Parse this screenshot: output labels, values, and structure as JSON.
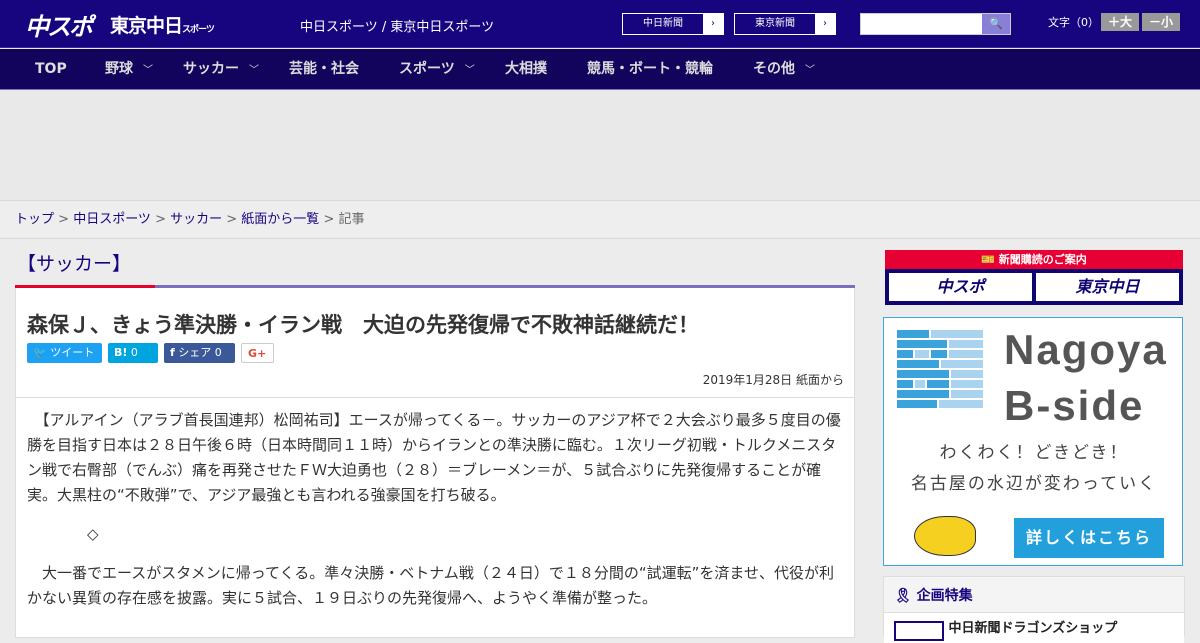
{
  "header": {
    "logo_chuspo": "中スポ",
    "logo_tokyo": "東京中日",
    "logo_tokyo_small": "スポーツ",
    "tagline": "中日スポーツ / 東京中日スポーツ",
    "link1": "中日新聞",
    "link2": "東京新聞",
    "search_placeholder": "",
    "font_label": "文字（0）",
    "font_up": "＋大",
    "font_down": "－小"
  },
  "nav": [
    {
      "label": "TOP"
    },
    {
      "label": "野球",
      "dd": true
    },
    {
      "label": "サッカー",
      "dd": true
    },
    {
      "label": "芸能・社会"
    },
    {
      "label": "スポーツ",
      "dd": true
    },
    {
      "label": "大相撲"
    },
    {
      "label": "競馬・ボート・競輪"
    },
    {
      "label": "その他",
      "dd": true
    }
  ],
  "breadcrumb": [
    "トップ",
    "中日スポーツ",
    "サッカー",
    "紙面から一覧",
    "記事"
  ],
  "category": "【サッカー】",
  "article": {
    "title": "森保Ｊ、きょう準決勝・イラン戦　大迫の先発復帰で不敗神話継続だ！",
    "share": {
      "tweet": "ツイート",
      "hatena": "B!",
      "hatena_count": "0",
      "facebook": "シェア",
      "facebook_count": "0",
      "gplus": "G+"
    },
    "date": "2019年1月28日 紙面から",
    "paragraphs": [
      "　【アルアイン（アラブ首長国連邦）松岡祐司】エースが帰ってくる－。サッカーのアジア杯で２大会ぶり最多５度目の優勝を目指す日本は２８日午後６時（日本時間同１１時）からイランとの準決勝に臨む。１次リーグ初戦・トルクメニスタン戦で右臀部（でんぶ）痛を再発させたＦＷ大迫勇也（２８）＝ブレーメン＝が、５試合ぶりに先発復帰することが確実。大黒柱の“不敗弾”で、アジア最強とも言われる強豪国を打ち破る。",
      "　　　　◇",
      "　大一番でエースがスタメンに帰ってくる。準々決勝・ベトナム戦（２４日）で１８分間の“試運転”を済ませ、代役が利かない異質の存在感を披露。実に５試合、１９日ぶりの先発復帰へ、ようやく準備が整った。"
    ]
  },
  "sidebar": {
    "subscribe_title": "新聞購読のご案内",
    "sub1": "中スポ",
    "sub2": "東京中日",
    "bside": {
      "name1": "Nagoya",
      "name2": "B-side",
      "line1": "わくわく！どきどき！",
      "line2": "名古屋の水辺が変わっていく",
      "button": "詳しくはこちら"
    },
    "feature_title": "企画特集",
    "feature_item": "中日新聞ドラゴンズショップ"
  },
  "colors": {
    "header": "#17057f",
    "nav": "#12045c",
    "accent_red": "#e6002d",
    "bside_blue": "#23a0dc"
  }
}
